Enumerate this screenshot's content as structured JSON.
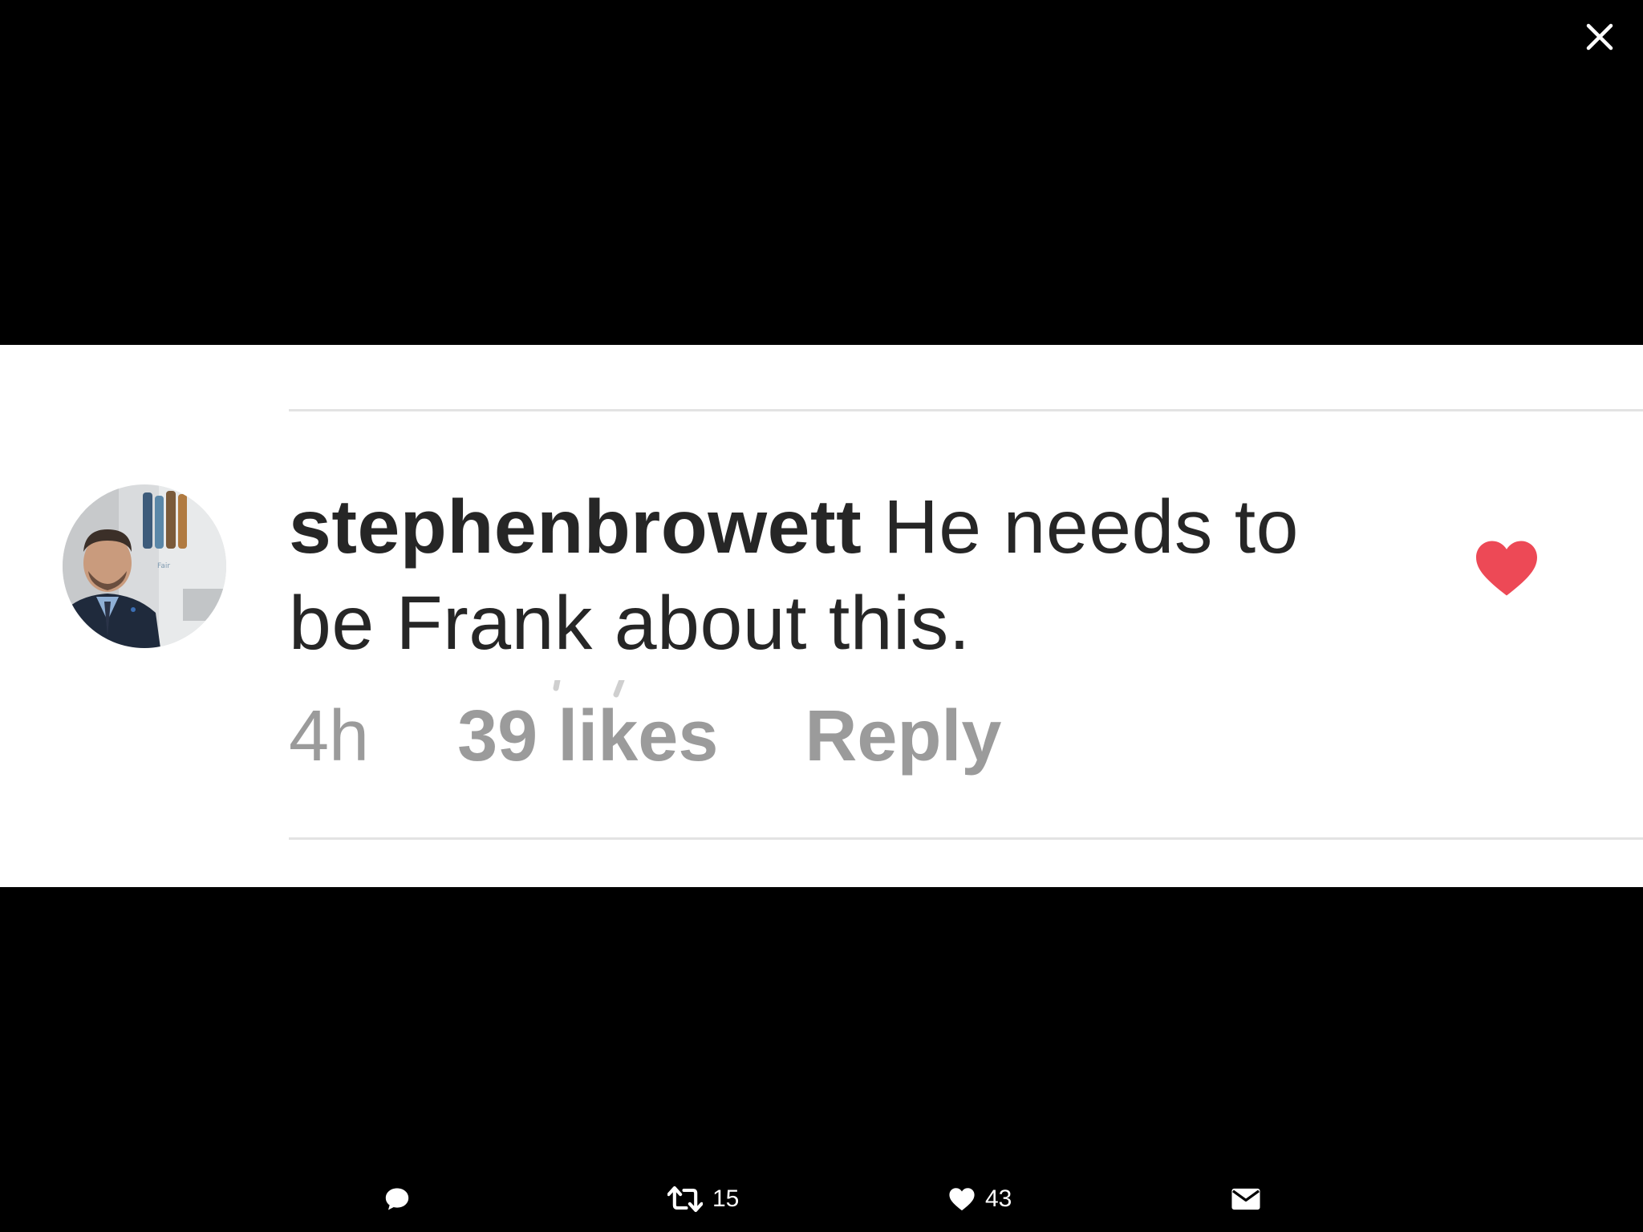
{
  "viewer": {
    "close_icon": "close-icon"
  },
  "comment": {
    "username": "stephenbrowett",
    "text": " He needs to be Frank about this.",
    "time": "4h",
    "likes": "39 likes",
    "reply": "Reply",
    "liked": true,
    "like_color": "#ED4956"
  },
  "actions": {
    "reply_icon": "reply-icon",
    "retweet_icon": "retweet-icon",
    "retweet_count": "15",
    "like_icon": "heart-icon",
    "like_count": "43",
    "dm_icon": "envelope-icon"
  },
  "colors": {
    "background": "#000000",
    "card": "#FFFFFF",
    "text": "#262626",
    "meta_text": "#9B9B9B"
  }
}
